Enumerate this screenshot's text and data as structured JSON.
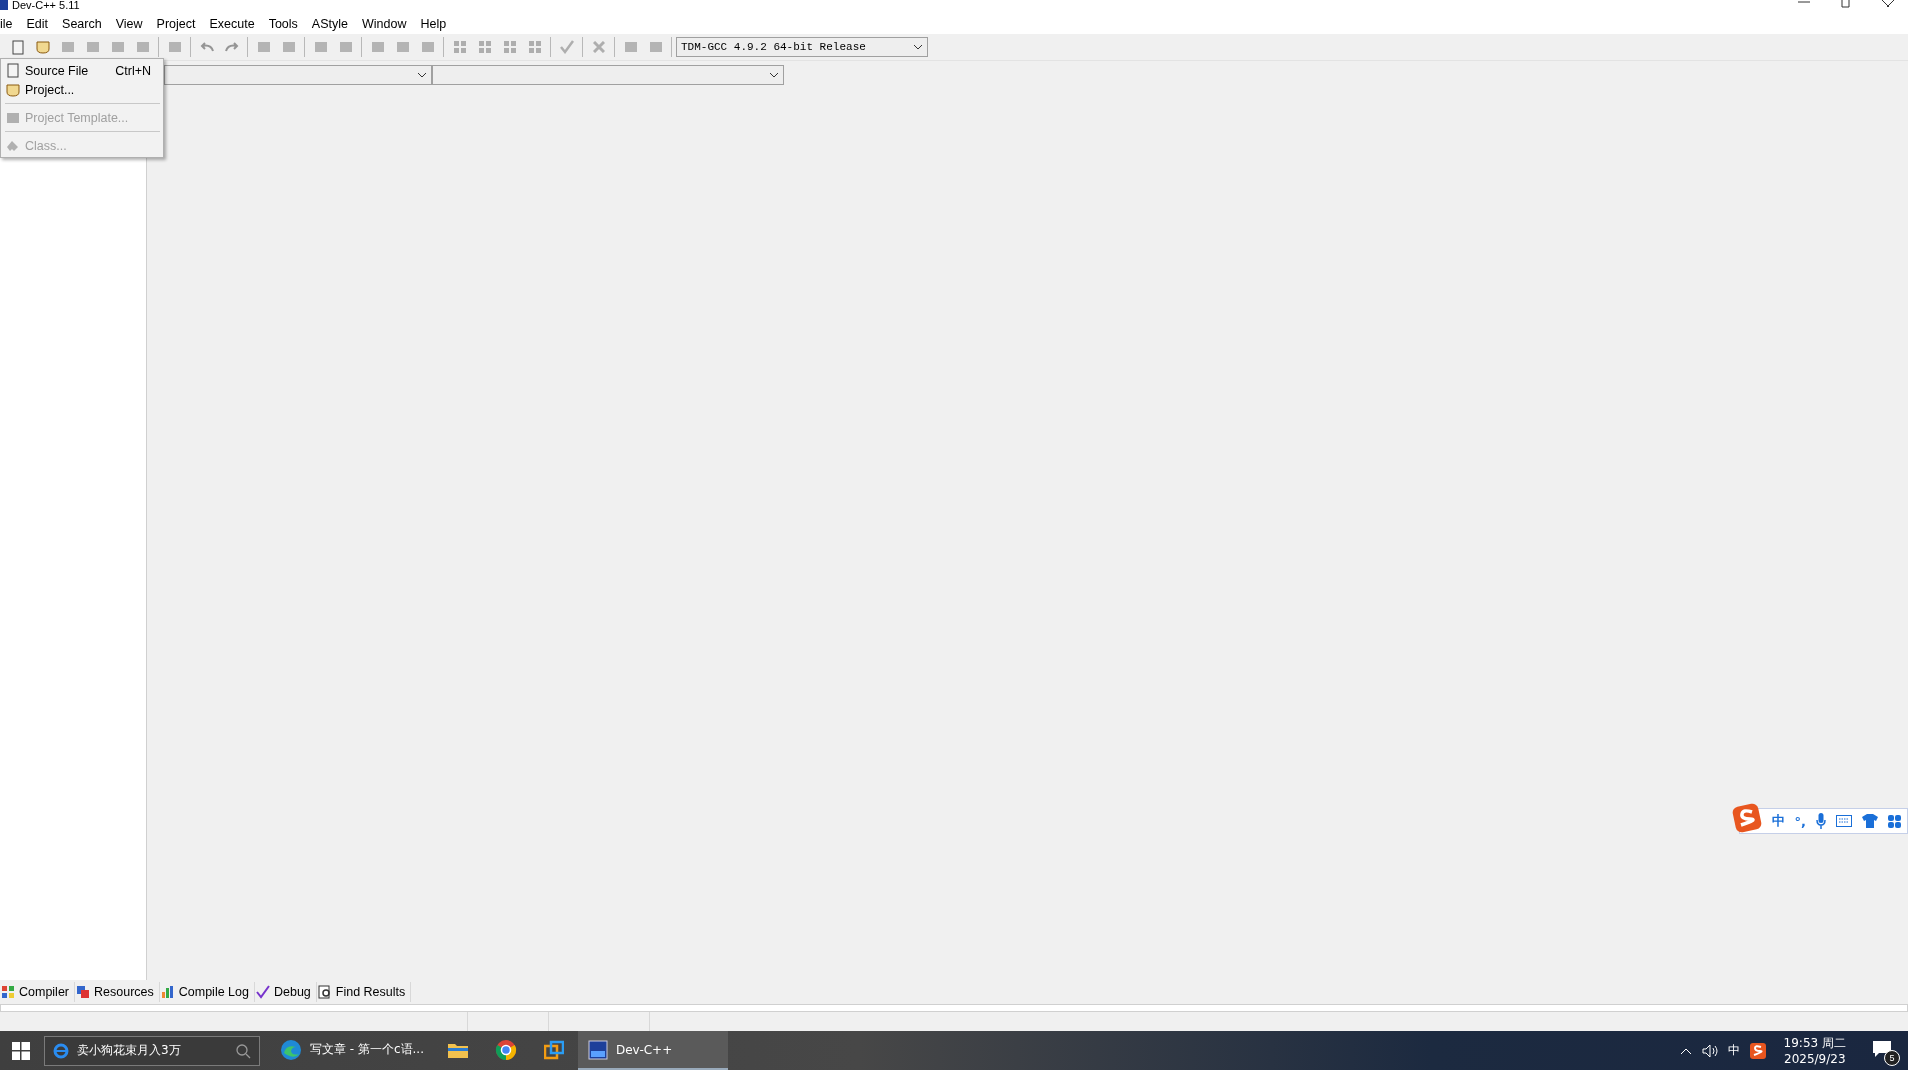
{
  "window": {
    "title": "Dev-C++ 5.11"
  },
  "menu_bar": [
    "ile",
    "Edit",
    "Search",
    "View",
    "Project",
    "Execute",
    "Tools",
    "AStyle",
    "Window",
    "Help"
  ],
  "toolbar_groups": [
    {
      "buttons": [
        {
          "disabled": false
        },
        {
          "disabled": false
        },
        {
          "disabled": true
        },
        {
          "disabled": true
        },
        {
          "disabled": true
        },
        {
          "disabled": true
        }
      ]
    },
    {
      "buttons": [
        {
          "disabled": true
        }
      ]
    },
    {
      "buttons": [
        {
          "disabled": true
        },
        {
          "disabled": true
        }
      ]
    },
    {
      "buttons": [
        {
          "disabled": true
        },
        {
          "disabled": true
        }
      ]
    },
    {
      "buttons": [
        {
          "disabled": true
        },
        {
          "disabled": true
        }
      ]
    },
    {
      "buttons": [
        {
          "disabled": true
        },
        {
          "disabled": true
        },
        {
          "disabled": true
        }
      ]
    },
    {
      "buttons": [
        {
          "disabled": true
        },
        {
          "disabled": true
        },
        {
          "disabled": true
        },
        {
          "disabled": true
        }
      ]
    },
    {
      "buttons": [
        {
          "disabled": true
        }
      ]
    },
    {
      "buttons": [
        {
          "disabled": true
        }
      ]
    },
    {
      "buttons": [
        {
          "disabled": true
        },
        {
          "disabled": true
        }
      ]
    }
  ],
  "compiler_select": {
    "value": "TDM-GCC 4.9.2 64-bit Release"
  },
  "new_menu": [
    {
      "kind": "item",
      "label": "Source File",
      "shortcut": "Ctrl+N",
      "disabled": false
    },
    {
      "kind": "item",
      "label": "Project...",
      "disabled": false
    },
    {
      "kind": "separator"
    },
    {
      "kind": "item",
      "label": "Project Template...",
      "disabled": true
    },
    {
      "kind": "separator"
    },
    {
      "kind": "item",
      "label": "Class...",
      "disabled": true
    }
  ],
  "bottom_tabs": [
    {
      "label": "Compiler",
      "selected": false
    },
    {
      "label": "Resources",
      "selected": false
    },
    {
      "label": "Compile Log",
      "selected": false
    },
    {
      "label": "Debug",
      "selected": false
    },
    {
      "label": "Find Results",
      "selected": false
    }
  ],
  "ime_toolbar": {
    "mode": "中",
    "punctuation": "°,"
  },
  "taskbar": {
    "search": {
      "value": "卖小狗花束月入3万"
    },
    "apps": [
      {
        "kind": "edge",
        "label": "写文章 - 第一个c语...",
        "selected": false
      },
      {
        "kind": "explorer",
        "selected": false
      },
      {
        "kind": "chrome",
        "selected": false
      },
      {
        "kind": "remote",
        "selected": false
      },
      {
        "kind": "devcpp",
        "label": "Dev-C++",
        "selected": true
      }
    ],
    "input_indicator": "中",
    "time": "19:53 周二",
    "date": "2025/9/23",
    "notifications": "5"
  }
}
